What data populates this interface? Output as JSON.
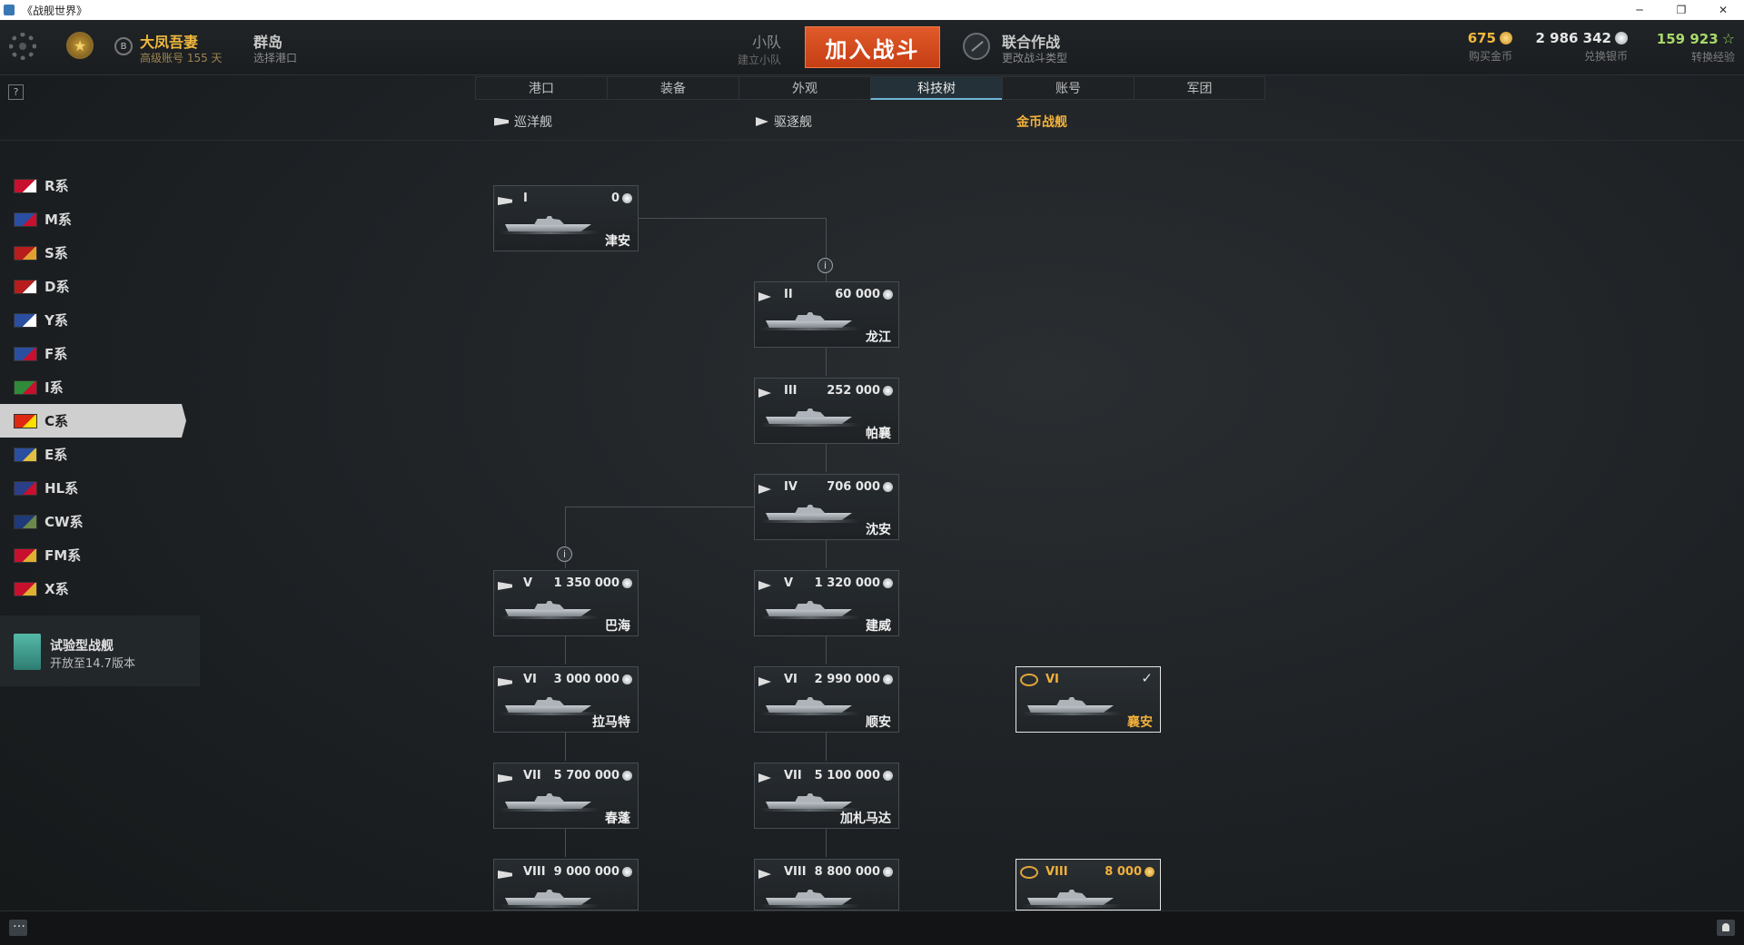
{
  "window": {
    "title": "《战舰世界》",
    "controls": [
      "─",
      "❐",
      "✕"
    ]
  },
  "header": {
    "rank_badge": "B",
    "player_name": "大凤吾妻",
    "account_info": "高级账号  155 天",
    "port": {
      "title": "群岛",
      "subtitle": "选择港口"
    },
    "squad": {
      "title": "小队",
      "subtitle": "建立小队"
    },
    "battle_button": "加入战斗",
    "mode": {
      "title": "联合作战",
      "subtitle": "更改战斗类型"
    },
    "currencies": [
      {
        "value": "675",
        "label": "购买金币",
        "icon": "gold-coin-icon",
        "color": "#f1b93d"
      },
      {
        "value": "2 986 342",
        "label": "兑换银币",
        "icon": "silver-coin-icon",
        "color": "#e6e6e6"
      },
      {
        "value": "159 923",
        "label": "转换经验",
        "icon": "star-icon",
        "color": "#a8d96a"
      }
    ]
  },
  "tabs": [
    {
      "label": "港口",
      "active": false
    },
    {
      "label": "装备",
      "active": false
    },
    {
      "label": "外观",
      "active": false
    },
    {
      "label": "科技树",
      "active": true
    },
    {
      "label": "账号",
      "active": false
    },
    {
      "label": "军团",
      "active": false
    }
  ],
  "help_label": "?",
  "subtabs": [
    {
      "label": "巡洋舰",
      "icon": "cruiser-class-icon"
    },
    {
      "label": "驱逐舰",
      "icon": "destroyer-class-icon"
    },
    {
      "label": "金币战舰",
      "icon": ""
    }
  ],
  "nations": [
    {
      "label": "R系",
      "flag_colors": [
        "#c8102e",
        "#ffffff"
      ],
      "active": false
    },
    {
      "label": "M系",
      "flag_colors": [
        "#2b4ea2",
        "#c8102e"
      ],
      "active": false
    },
    {
      "label": "S系",
      "flag_colors": [
        "#b81d1d",
        "#e0a030"
      ],
      "active": false
    },
    {
      "label": "D系",
      "flag_colors": [
        "#b81d1d",
        "#ffffff"
      ],
      "active": false
    },
    {
      "label": "Y系",
      "flag_colors": [
        "#2a4fa0",
        "#ffffff"
      ],
      "active": false
    },
    {
      "label": "F系",
      "flag_colors": [
        "#2a4fa0",
        "#c8102e"
      ],
      "active": false
    },
    {
      "label": "I系",
      "flag_colors": [
        "#2f8a3a",
        "#c8102e"
      ],
      "active": false
    },
    {
      "label": "C系",
      "flag_colors": [
        "#de2910",
        "#ffde00"
      ],
      "active": true
    },
    {
      "label": "E系",
      "flag_colors": [
        "#2a4fa0",
        "#e0c040"
      ],
      "active": false
    },
    {
      "label": "HL系",
      "flag_colors": [
        "#2a3f88",
        "#c8102e"
      ],
      "active": false
    },
    {
      "label": "CW系",
      "flag_colors": [
        "#1e3a78",
        "#6b8a4a"
      ],
      "active": false
    },
    {
      "label": "FM系",
      "flag_colors": [
        "#c8102e",
        "#e0b030"
      ],
      "active": false
    },
    {
      "label": "X系",
      "flag_colors": [
        "#c8102e",
        "#e0b030"
      ],
      "active": false
    }
  ],
  "experimental": {
    "title": "试验型战舰",
    "subtitle": "开放至14.7版本"
  },
  "ships": [
    {
      "id": "tianjin",
      "tier": "I",
      "cost": "0",
      "currency": "silver",
      "name": "津安",
      "class": "cruiser",
      "premium": false,
      "owned": false
    },
    {
      "id": "longjiang",
      "tier": "II",
      "cost": "60 000",
      "currency": "silver",
      "name": "龙江",
      "class": "destroyer",
      "premium": false,
      "owned": false
    },
    {
      "id": "phra-ruang",
      "tier": "III",
      "cost": "252 000",
      "currency": "silver",
      "name": "帕襄",
      "class": "destroyer",
      "premium": false,
      "owned": false
    },
    {
      "id": "shenyang",
      "tier": "IV",
      "cost": "706 000",
      "currency": "silver",
      "name": "沈安",
      "class": "destroyer",
      "premium": false,
      "owned": false
    },
    {
      "id": "bahai",
      "tier": "V",
      "cost": "1 350 000",
      "currency": "silver",
      "name": "巴海",
      "class": "cruiser",
      "premium": false,
      "owned": false
    },
    {
      "id": "jianwei",
      "tier": "V",
      "cost": "1 320 000",
      "currency": "silver",
      "name": "建威",
      "class": "destroyer",
      "premium": false,
      "owned": false
    },
    {
      "id": "lamat",
      "tier": "VI",
      "cost": "3 000 000",
      "currency": "silver",
      "name": "拉马特",
      "class": "cruiser",
      "premium": false,
      "owned": false
    },
    {
      "id": "shunan",
      "tier": "VI",
      "cost": "2 990 000",
      "currency": "silver",
      "name": "顺安",
      "class": "destroyer",
      "premium": false,
      "owned": false
    },
    {
      "id": "xiangan",
      "tier": "VI",
      "cost": "",
      "currency": "",
      "name": "襄安",
      "class": "destroyer",
      "premium": true,
      "owned": true
    },
    {
      "id": "chunpeng",
      "tier": "VII",
      "cost": "5 700 000",
      "currency": "silver",
      "name": "春蓬",
      "class": "cruiser",
      "premium": false,
      "owned": false
    },
    {
      "id": "gadjah-mada",
      "tier": "VII",
      "cost": "5 100 000",
      "currency": "silver",
      "name": "加札马达",
      "class": "destroyer",
      "premium": false,
      "owned": false
    },
    {
      "id": "cruiser-viii",
      "tier": "VIII",
      "cost": "9 000 000",
      "currency": "silver",
      "name": "",
      "class": "cruiser",
      "premium": false,
      "owned": false
    },
    {
      "id": "destroyer-viii",
      "tier": "VIII",
      "cost": "8 800 000",
      "currency": "silver",
      "name": "",
      "class": "destroyer",
      "premium": false,
      "owned": false
    },
    {
      "id": "premium-viii",
      "tier": "VIII",
      "cost": "8 000",
      "currency": "gold",
      "name": "",
      "class": "destroyer",
      "premium": true,
      "owned": false
    }
  ]
}
